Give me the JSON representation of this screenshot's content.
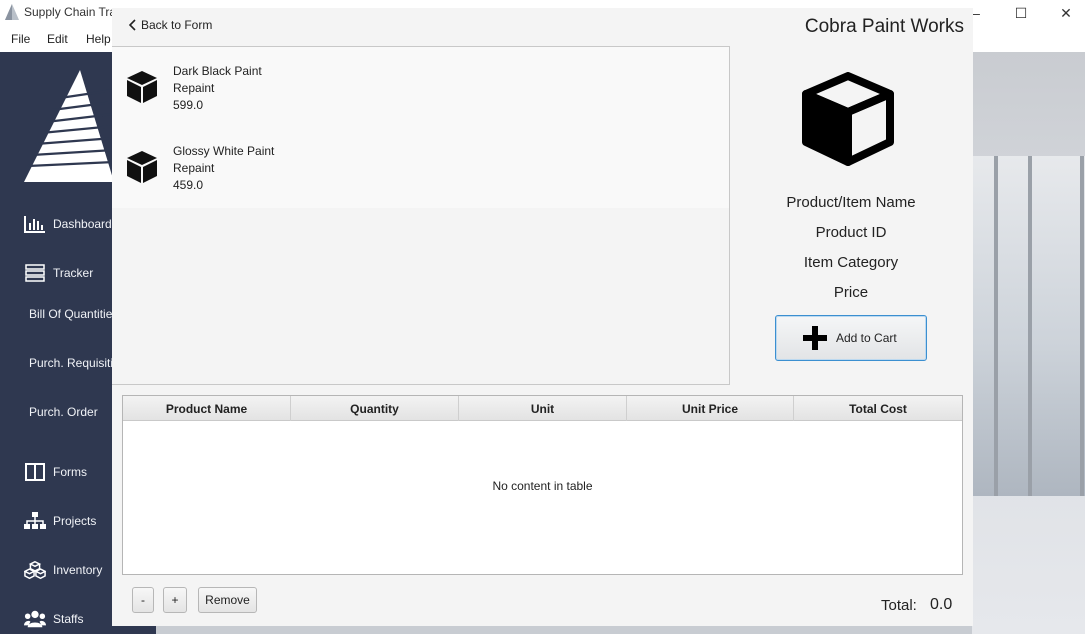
{
  "window": {
    "title": "Supply Chain Tra",
    "minimize": "–",
    "maximize": "☐",
    "close": "✕"
  },
  "menu": [
    "File",
    "Edit",
    "Help"
  ],
  "sidebar": {
    "items": [
      {
        "label": "Dashboard",
        "icon": "bar-chart-icon"
      },
      {
        "label": "Tracker",
        "icon": "server-icon"
      },
      {
        "label": "Bill Of Quantitie",
        "icon": ""
      },
      {
        "label": "Purch. Requisitio",
        "icon": ""
      },
      {
        "label": "Purch. Order",
        "icon": ""
      },
      {
        "label": "Forms",
        "icon": "columns-icon"
      },
      {
        "label": "Projects",
        "icon": "sitemap-icon"
      },
      {
        "label": "Inventory",
        "icon": "cubes-icon"
      },
      {
        "label": "Staffs",
        "icon": "users-icon"
      }
    ]
  },
  "dialog": {
    "back_label": "Back to Form",
    "shop_name": "Cobra Paint Works",
    "products": [
      {
        "name": "Dark Black Paint",
        "category": "Repaint",
        "price": "599.0"
      },
      {
        "name": "Glossy White Paint",
        "category": "Repaint",
        "price": "459.0"
      }
    ],
    "detail": {
      "name": "Product/Item Name",
      "id": "Product ID",
      "category": "Item Category",
      "price": "Price",
      "add_to_cart": "Add to Cart"
    },
    "table": {
      "columns": [
        "Product Name",
        "Quantity",
        "Unit",
        "Unit Price",
        "Total Cost"
      ],
      "empty_message": "No content in table"
    },
    "buttons": {
      "minus": "-",
      "plus": "+",
      "remove": "Remove"
    },
    "total_label": "Total:",
    "total_value": "0.0"
  },
  "colors": {
    "sidebar_bg": "#2f3850",
    "dialog_bg": "#f4f4f4",
    "accent_border": "#3b8fd0"
  }
}
